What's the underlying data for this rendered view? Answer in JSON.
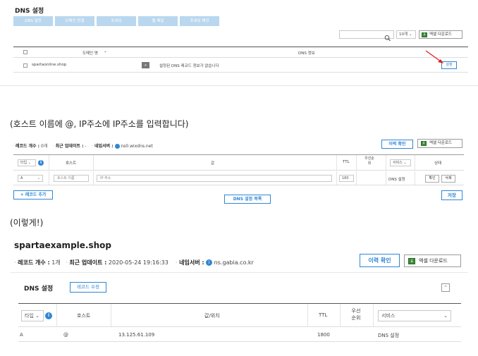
{
  "top": {
    "title": "DNS 설정",
    "tabs": [
      "DNS 설정",
      "도메인 연결",
      "포워딩",
      "웹 메일",
      "포워딩 해킹"
    ],
    "per_page": "10개",
    "excel": "엑셀 다운로드",
    "headers": {
      "domain": "도메인 명",
      "dns_info": "DNS 정보"
    },
    "row": {
      "domain": "spartaonline.shop",
      "info": "설정된 DNS 레코드 정보가 없습니다",
      "action": "설정"
    }
  },
  "captions": {
    "first": "(호스트 이름에 @, IP주소에 IP주소를 입력합니다)",
    "second": "(이렇게!)"
  },
  "middle": {
    "record_count_label": "레코드 개수 :",
    "record_count_value": "0개",
    "last_update_label": "최근 업데이트 :",
    "last_update_value": "-",
    "nameserver_label": "네임서버 :",
    "nameserver_value": "ns0.wixdns.net",
    "history_btn": "이력 확인",
    "excel_btn": "엑셀 다운로드",
    "headers": {
      "type": "타입",
      "host": "호스트",
      "value": "값",
      "ttl": "TTL",
      "priority": "우선순위",
      "service": "서비스",
      "status": "상태"
    },
    "row": {
      "type": "A",
      "host_placeholder": "호스트 이름",
      "value_placeholder": "IP 주소",
      "ttl": "180",
      "service": "DNS 설정",
      "confirm_btn": "확인",
      "delete_btn": "삭제"
    },
    "add_record": "+ 레코드 추가",
    "dns_list": "DNS 설정 목록",
    "save": "저장"
  },
  "bottom": {
    "domain": "spartaexample.shop",
    "record_count_label": "레코드 개수 :",
    "record_count_value": "1개",
    "last_update_label": "최근 업데이트 :",
    "last_update_value": "2020-05-24 19:16:33",
    "nameserver_label": "네임서버 :",
    "nameserver_value": "ns.gabia.co.kr",
    "history_btn": "이력 확인",
    "excel_btn": "엑셀 다운로드",
    "dns_title": "DNS 설정",
    "edit_btn": "레코드 수정",
    "headers": {
      "type": "타입",
      "host": "호스트",
      "value": "값/위치",
      "ttl": "TTL",
      "priority": "우선순위",
      "service": "서비스"
    },
    "row": {
      "type": "A",
      "host": "@",
      "value": "13.125.61.109",
      "ttl": "1800",
      "service": "DNS 설정"
    }
  },
  "colors": {
    "accent": "#2f86d6",
    "tab_bg": "#b9d7ef",
    "red_arrow": "#e02020",
    "excel_green": "#3d8c3d"
  }
}
